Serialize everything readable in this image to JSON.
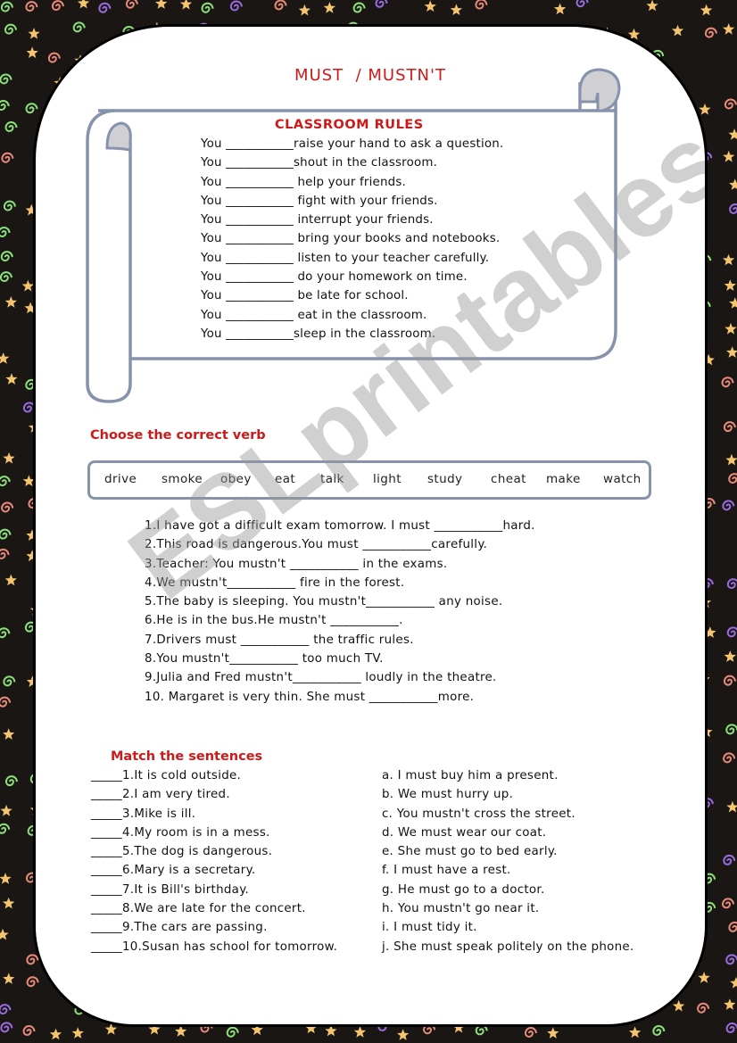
{
  "title": "MUST  / MUSTN'T",
  "rules": {
    "heading": "CLASSROOM RULES",
    "lines": [
      "You ___________raise your hand to ask a question.",
      "You ___________shout in the classroom.",
      "You ___________ help your friends.",
      "You ___________ fight with your friends.",
      "You ___________ interrupt your friends.",
      "You ___________ bring your books and notebooks.",
      "You ___________ listen to your teacher carefully.",
      "You ___________ do your homework on time.",
      "You ___________ be late for school.",
      "You ___________ eat in the classroom.",
      "You ___________sleep in the classroom."
    ]
  },
  "choose_verb": {
    "heading": "Choose the correct verb",
    "verbs": [
      "drive",
      "smoke",
      "obey",
      "eat",
      "talk",
      "light",
      "study",
      "cheat",
      "make",
      "watch"
    ],
    "sentences": [
      "1.I have got a difficult exam tomorrow. I must ___________hard.",
      "2.This road is dangerous.You must ___________carefully.",
      "3.Teacher: You mustn't ___________ in the exams.",
      "4.We mustn't___________ fire in the forest.",
      "5.The baby is sleeping. You mustn't___________ any noise.",
      "6.He is in the bus.He mustn't ___________.",
      "7.Drivers must ___________ the traffic rules.",
      "8.You mustn't___________ too much TV.",
      "9.Julia and Fred mustn't___________ loudly in the theatre.",
      "10. Margaret is very thin. She must ___________more."
    ]
  },
  "match": {
    "heading": "Match the sentences",
    "left": [
      "_____1.It is cold outside.",
      "_____2.I am very tired.",
      "_____3.Mike is ill.",
      "_____4.My room is in a mess.",
      "_____5.The dog is dangerous.",
      "_____6.Mary is a secretary.",
      "_____7.It is Bill's birthday.",
      "_____8.We are late for the concert.",
      "_____9.The cars are passing.",
      "_____10.Susan has school for tomorrow."
    ],
    "right": [
      "a. I must buy him a present.",
      "b. We must hurry up.",
      "c. You mustn't cross the street.",
      "d. We must wear our coat.",
      "e. She must go to bed early.",
      "f. I must have a rest.",
      "g. He must go to a doctor.",
      "h. You mustn't go near it.",
      "i. I must tidy it.",
      "j. She must speak politely on the phone."
    ]
  },
  "watermark": "ESLprintables.com",
  "colors": {
    "heading_red": "#cc1a1a",
    "scroll_border": "#8793ab",
    "scroll_curl": "#d0d0d4",
    "border_bg": "#1a1614"
  }
}
